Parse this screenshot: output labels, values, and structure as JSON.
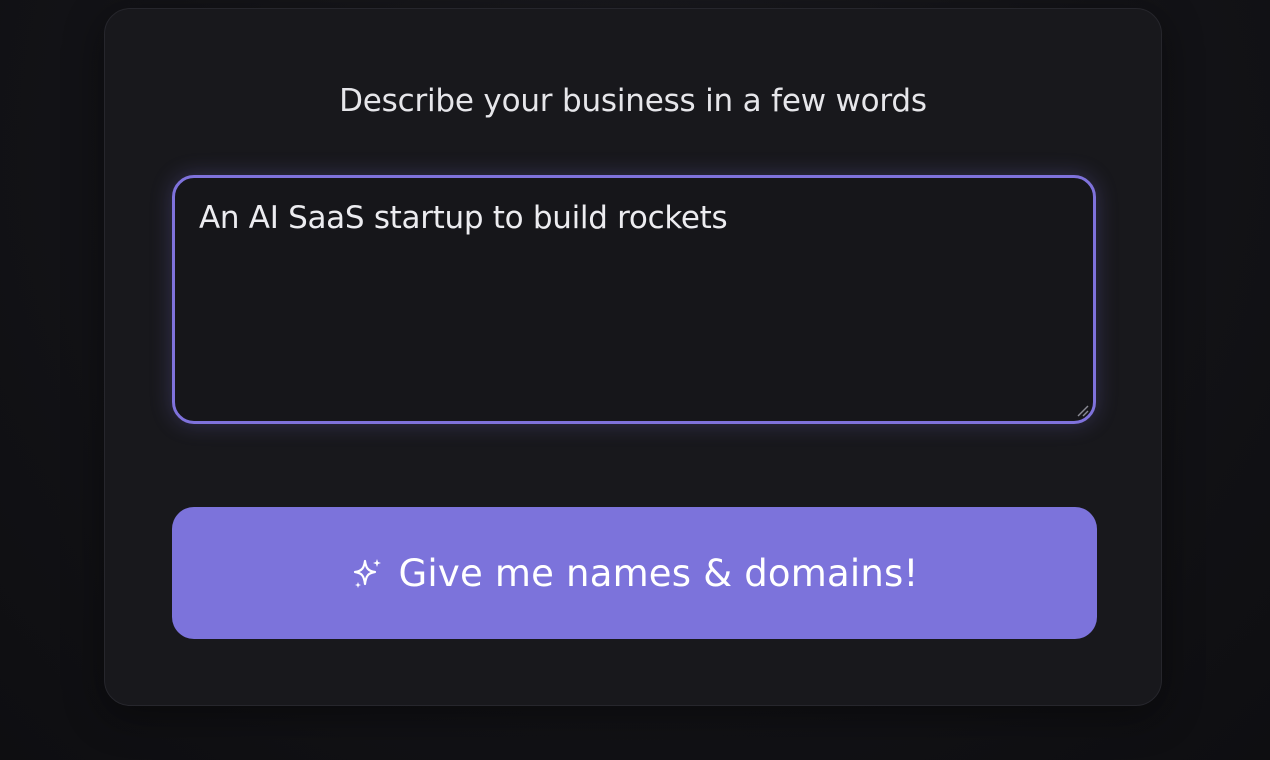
{
  "form": {
    "heading": "Describe your business in a few words",
    "description_value": "An AI SaaS startup to build rockets"
  },
  "submit": {
    "label": "Give me names & domains!",
    "icon": "sparkles-icon"
  },
  "colors": {
    "accent": "#7c73db",
    "card": "#18181c",
    "background": "#131317"
  }
}
